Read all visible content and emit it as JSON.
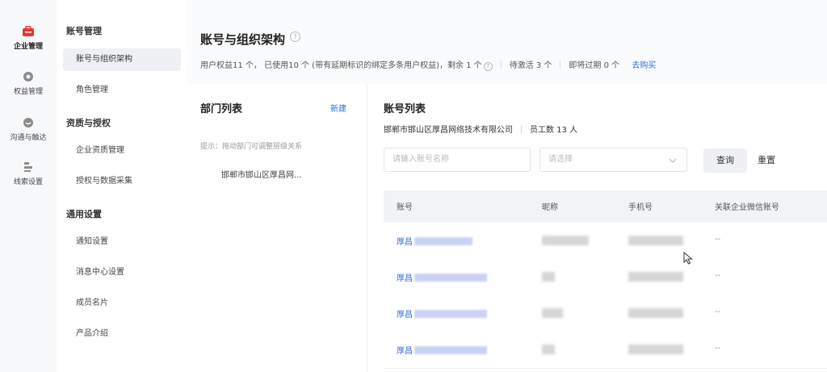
{
  "rail": {
    "items": [
      {
        "label": "企业管理",
        "icon": "briefcase-icon",
        "active": true
      },
      {
        "label": "权益管理",
        "icon": "circle-icon",
        "active": false
      },
      {
        "label": "沟通与触达",
        "icon": "chat-icon",
        "active": false
      },
      {
        "label": "线索设置",
        "icon": "list-icon",
        "active": false
      }
    ]
  },
  "sidebar": {
    "groups": [
      {
        "title": "账号管理",
        "items": [
          "账号与组织架构",
          "角色管理"
        ]
      },
      {
        "title": "资质与授权",
        "items": [
          "企业资质管理",
          "授权与数据采集"
        ]
      },
      {
        "title": "通用设置",
        "items": [
          "通知设置",
          "消息中心设置",
          "成员名片",
          "产品介绍"
        ]
      }
    ],
    "active_item": "账号与组织架构"
  },
  "page": {
    "title": "账号与组织架构",
    "summary": {
      "rights": "用户权益11 个， 已使用10 个 (带有延期标识的绑定多条用户权益)，剩余 1 个",
      "pending": "待激活 3 个",
      "expiring": "即将过期 0 个",
      "buy_link": "去购买"
    }
  },
  "dept_panel": {
    "title": "部门列表",
    "new_label": "新建",
    "tip": "提示：拖动部门可调整层级关系",
    "company_node": "邯郸市邯山区厚昌网..."
  },
  "acct_panel": {
    "title": "账号列表",
    "company": "邯郸市邯山区厚昌网络技术有限公司",
    "staff_count": "员工数 13 人",
    "search_placeholder": "请输入账号名称",
    "select_placeholder": "请选择",
    "query_label": "查询",
    "reset_label": "重置",
    "columns": [
      "账号",
      "昵称",
      "手机号",
      "关联企业微信账号"
    ],
    "rows": [
      {
        "account_prefix": "厚昌",
        "wecom": "--"
      },
      {
        "account_prefix": "厚昌",
        "wecom": "--"
      },
      {
        "account_prefix": "厚昌",
        "wecom": "--"
      },
      {
        "account_prefix": "厚昌",
        "wecom": "--"
      }
    ]
  },
  "colors": {
    "link": "#2f6fe0",
    "brand_red": "#e8382f"
  }
}
